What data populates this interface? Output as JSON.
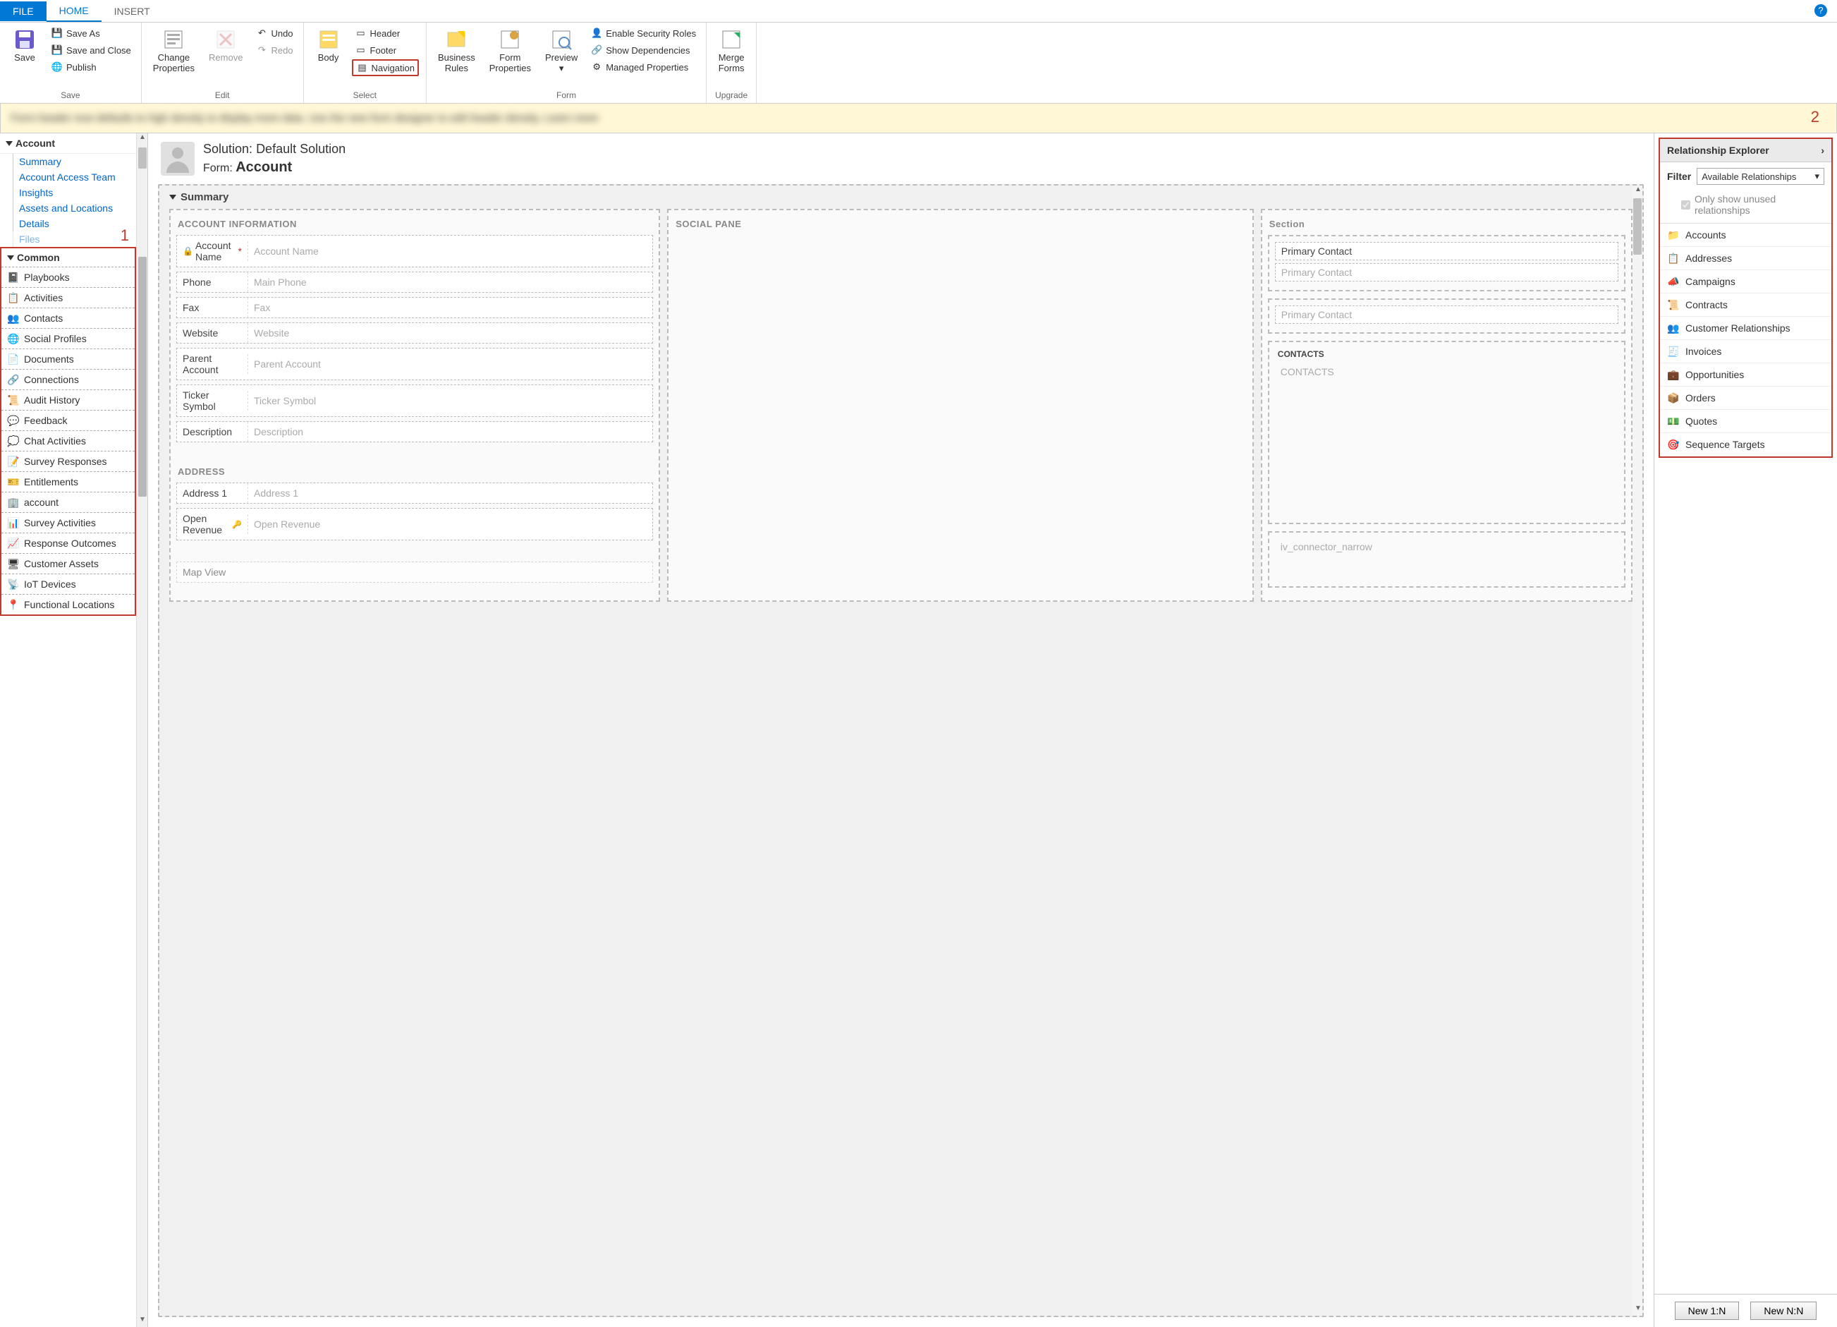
{
  "tabs": {
    "file": "FILE",
    "home": "HOME",
    "insert": "INSERT"
  },
  "ribbon": {
    "save": {
      "save": "Save",
      "save_as": "Save As",
      "save_close": "Save and Close",
      "publish": "Publish",
      "group": "Save"
    },
    "edit": {
      "change_props": "Change\nProperties",
      "remove": "Remove",
      "undo": "Undo",
      "redo": "Redo",
      "group": "Edit"
    },
    "select": {
      "body": "Body",
      "header": "Header",
      "footer": "Footer",
      "navigation": "Navigation",
      "group": "Select"
    },
    "form": {
      "br": "Business\nRules",
      "fp": "Form\nProperties",
      "preview": "Preview",
      "esr": "Enable Security Roles",
      "sd": "Show Dependencies",
      "mp": "Managed Properties",
      "group": "Form"
    },
    "upgrade": {
      "merge": "Merge\nForms",
      "group": "Upgrade"
    }
  },
  "notify_blur": "Form header now defaults to high density to display more data. Use the new form designer to edit header density. Learn more",
  "markers": {
    "one": "1",
    "two": "2"
  },
  "left": {
    "account": "Account",
    "links": [
      "Summary",
      "Account Access Team",
      "Insights",
      "Assets and Locations",
      "Details",
      "Files"
    ],
    "common": "Common",
    "common_items": [
      {
        "icon": "📓",
        "label": "Playbooks"
      },
      {
        "icon": "📋",
        "label": "Activities"
      },
      {
        "icon": "👥",
        "label": "Contacts"
      },
      {
        "icon": "🌐",
        "label": "Social Profiles"
      },
      {
        "icon": "📄",
        "label": "Documents"
      },
      {
        "icon": "🔗",
        "label": "Connections"
      },
      {
        "icon": "📜",
        "label": "Audit History"
      },
      {
        "icon": "💬",
        "label": "Feedback"
      },
      {
        "icon": "💭",
        "label": "Chat Activities"
      },
      {
        "icon": "📝",
        "label": "Survey Responses"
      },
      {
        "icon": "🎫",
        "label": "Entitlements"
      },
      {
        "icon": "🏢",
        "label": "account"
      },
      {
        "icon": "📊",
        "label": "Survey Activities"
      },
      {
        "icon": "📈",
        "label": "Response Outcomes"
      },
      {
        "icon": "🖥",
        "label": "Customer Assets"
      },
      {
        "icon": "📡",
        "label": "IoT Devices"
      },
      {
        "icon": "📍",
        "label": "Functional Locations"
      }
    ]
  },
  "center": {
    "solution_label": "Solution: ",
    "solution_name": "Default Solution",
    "form_label": "Form: ",
    "form_name": "Account",
    "summary": "Summary",
    "account_info": "ACCOUNT INFORMATION",
    "fields": [
      {
        "label": "Account Name",
        "ph": "Account Name",
        "lock": true,
        "req": true
      },
      {
        "label": "Phone",
        "ph": "Main Phone"
      },
      {
        "label": "Fax",
        "ph": "Fax"
      },
      {
        "label": "Website",
        "ph": "Website"
      },
      {
        "label": "Parent Account",
        "ph": "Parent Account"
      },
      {
        "label": "Ticker Symbol",
        "ph": "Ticker Symbol"
      },
      {
        "label": "Description",
        "ph": "Description"
      }
    ],
    "address": "ADDRESS",
    "addr_fields": [
      {
        "label": "Address 1",
        "ph": "Address 1"
      },
      {
        "label": "Open Revenue",
        "ph": "Open Revenue",
        "key": true
      }
    ],
    "mapview": "Map View",
    "social": "SOCIAL PANE",
    "section": "Section",
    "primary_contact": "Primary Contact",
    "primary_contact_ph": "Primary Contact",
    "primary_contact2": "Primary Contact",
    "contacts": "CONTACTS",
    "contacts_ph": "CONTACTS",
    "iv": "iv_connector_narrow"
  },
  "right": {
    "title": "Relationship Explorer",
    "filter": "Filter",
    "filter_val": "Available Relationships",
    "cb": "Only show unused relationships",
    "items": [
      {
        "icon": "📁",
        "label": "Accounts",
        "color": "#d9a441"
      },
      {
        "icon": "📋",
        "label": "Addresses",
        "color": "#5a8fc7"
      },
      {
        "icon": "📣",
        "label": "Campaigns",
        "color": "#d9a441"
      },
      {
        "icon": "📜",
        "label": "Contracts",
        "color": "#c0392b"
      },
      {
        "icon": "👥",
        "label": "Customer Relationships",
        "color": "#666"
      },
      {
        "icon": "🧾",
        "label": "Invoices",
        "color": "#c0392b"
      },
      {
        "icon": "💼",
        "label": "Opportunities",
        "color": "#d9a441"
      },
      {
        "icon": "📦",
        "label": "Orders",
        "color": "#27ae60"
      },
      {
        "icon": "💵",
        "label": "Quotes",
        "color": "#27ae60"
      },
      {
        "icon": "🎯",
        "label": "Sequence Targets",
        "color": "#5a8fc7"
      }
    ],
    "new1n": "New 1:N",
    "newnn": "New N:N"
  }
}
